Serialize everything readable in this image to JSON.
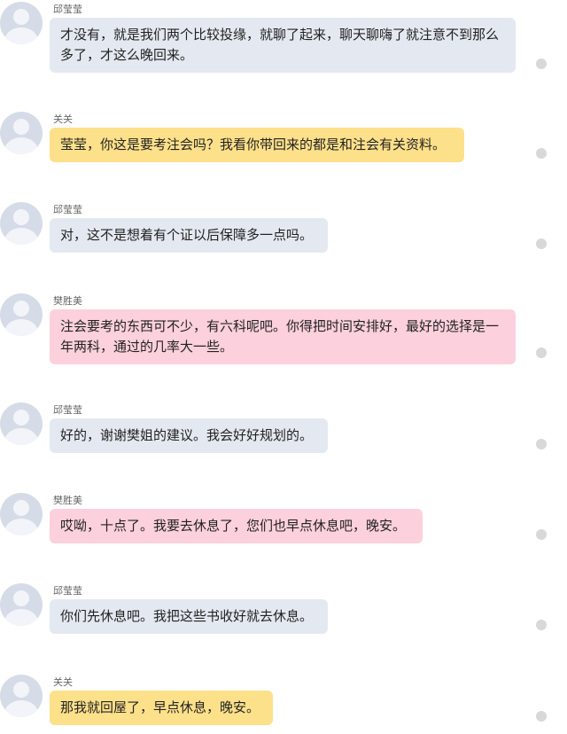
{
  "messages": [
    {
      "sender": "邱莹莹",
      "text": "才没有，就是我们两个比较投缘，就聊了起来，聊天聊嗨了就注意不到那么多了，才这么晚回来。",
      "bubble_color": "#e4e9f1"
    },
    {
      "sender": "关关",
      "text": "莹莹，你这是要考注会吗？我看你带回来的都是和注会有关资料。",
      "bubble_color": "#fde08a"
    },
    {
      "sender": "邱莹莹",
      "text": "对，这不是想着有个证以后保障多一点吗。",
      "bubble_color": "#e4e9f1"
    },
    {
      "sender": "樊胜美",
      "text": "注会要考的东西可不少，有六科呢吧。你得把时间安排好，最好的选择是一年两科，通过的几率大一些。",
      "bubble_color": "#fcd0dd"
    },
    {
      "sender": "邱莹莹",
      "text": "好的，谢谢樊姐的建议。我会好好规划的。",
      "bubble_color": "#e4e9f1"
    },
    {
      "sender": "樊胜美",
      "text": "哎呦，十点了。我要去休息了，您们也早点休息吧，晚安。",
      "bubble_color": "#fcd0dd"
    },
    {
      "sender": "邱莹莹",
      "text": "你们先休息吧。我把这些书收好就去休息。",
      "bubble_color": "#e4e9f1"
    },
    {
      "sender": "关关",
      "text": "那我就回屋了，早点休息，晚安。",
      "bubble_color": "#fde08a"
    }
  ]
}
